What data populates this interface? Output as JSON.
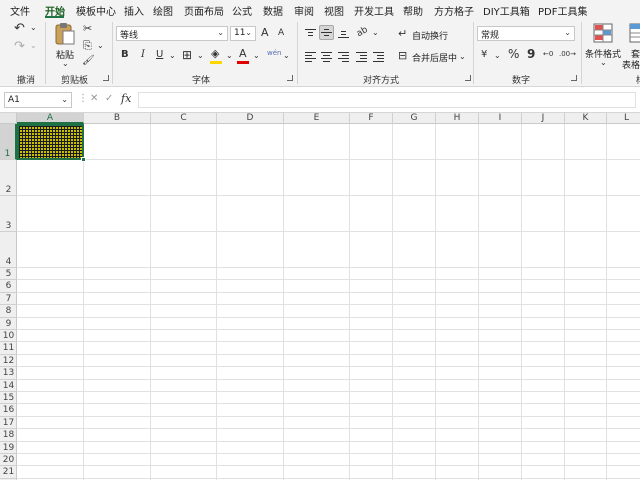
{
  "menubar": {
    "tabs": [
      "文件",
      "开始",
      "模板中心",
      "插入",
      "绘图",
      "页面布局",
      "公式",
      "数据",
      "审阅",
      "视图",
      "开发工具",
      "帮助",
      "方方格子",
      "DIY工具箱",
      "PDF工具集"
    ],
    "active_index": 1
  },
  "ribbon": {
    "undo": {
      "group_label": "撤消",
      "undo_icon": "↶",
      "redo_icon": "↷",
      "caret": "⌄"
    },
    "clipboard": {
      "group_label": "剪贴板",
      "paste_label": "粘贴",
      "paste_caret": "⌄",
      "cut_icon": "✂",
      "copy_icon": "⎘",
      "format_painter_icon": "🖌",
      "caret": "⌄"
    },
    "font": {
      "group_label": "字体",
      "font_name": "等线",
      "font_size": "11",
      "grow_label": "A",
      "shrink_label": "A",
      "bold": "B",
      "italic": "I",
      "underline": "U",
      "border_icon": "⊞",
      "fill_icon": "◈",
      "font_color_label": "A",
      "phonetic_label": "wén",
      "caret": "⌄",
      "fill_color": "#ffd700",
      "font_color": "#e00000"
    },
    "alignment": {
      "group_label": "对齐方式",
      "orientation_icon": "ab",
      "wrap_label": "自动换行",
      "wrap_icon": "↵",
      "merge_label": "合并后居中",
      "merge_icon": "⊟",
      "caret": "⌄"
    },
    "number": {
      "group_label": "数字",
      "format": "常规",
      "currency_icon": "¥",
      "percent": "%",
      "comma": "9",
      "inc_decimal": "←0",
      "dec_decimal": ".00→",
      "caret": "⌄"
    },
    "styles": {
      "conditional_label": "条件格式",
      "conditional_caret": "⌄",
      "table_label_top": "套",
      "table_label_bottom": "表格格",
      "partial_group": "样"
    }
  },
  "formula_bar": {
    "name_box": "A1",
    "name_caret": "⌄",
    "more_icon": "⋮",
    "cancel_icon": "✕",
    "confirm_icon": "✓",
    "fx_label": "fx",
    "value": ""
  },
  "grid": {
    "columns": [
      "A",
      "B",
      "C",
      "D",
      "E",
      "F",
      "G",
      "H",
      "I",
      "J",
      "K",
      "L"
    ],
    "rows": [
      "1",
      "2",
      "3",
      "4",
      "5",
      "6",
      "7",
      "8",
      "9",
      "10",
      "11",
      "12",
      "13",
      "14",
      "15",
      "16",
      "17",
      "18",
      "19",
      "20",
      "21"
    ],
    "selected_cell": "A1",
    "accent": "#217346",
    "a1_fill": "#c8c000"
  }
}
